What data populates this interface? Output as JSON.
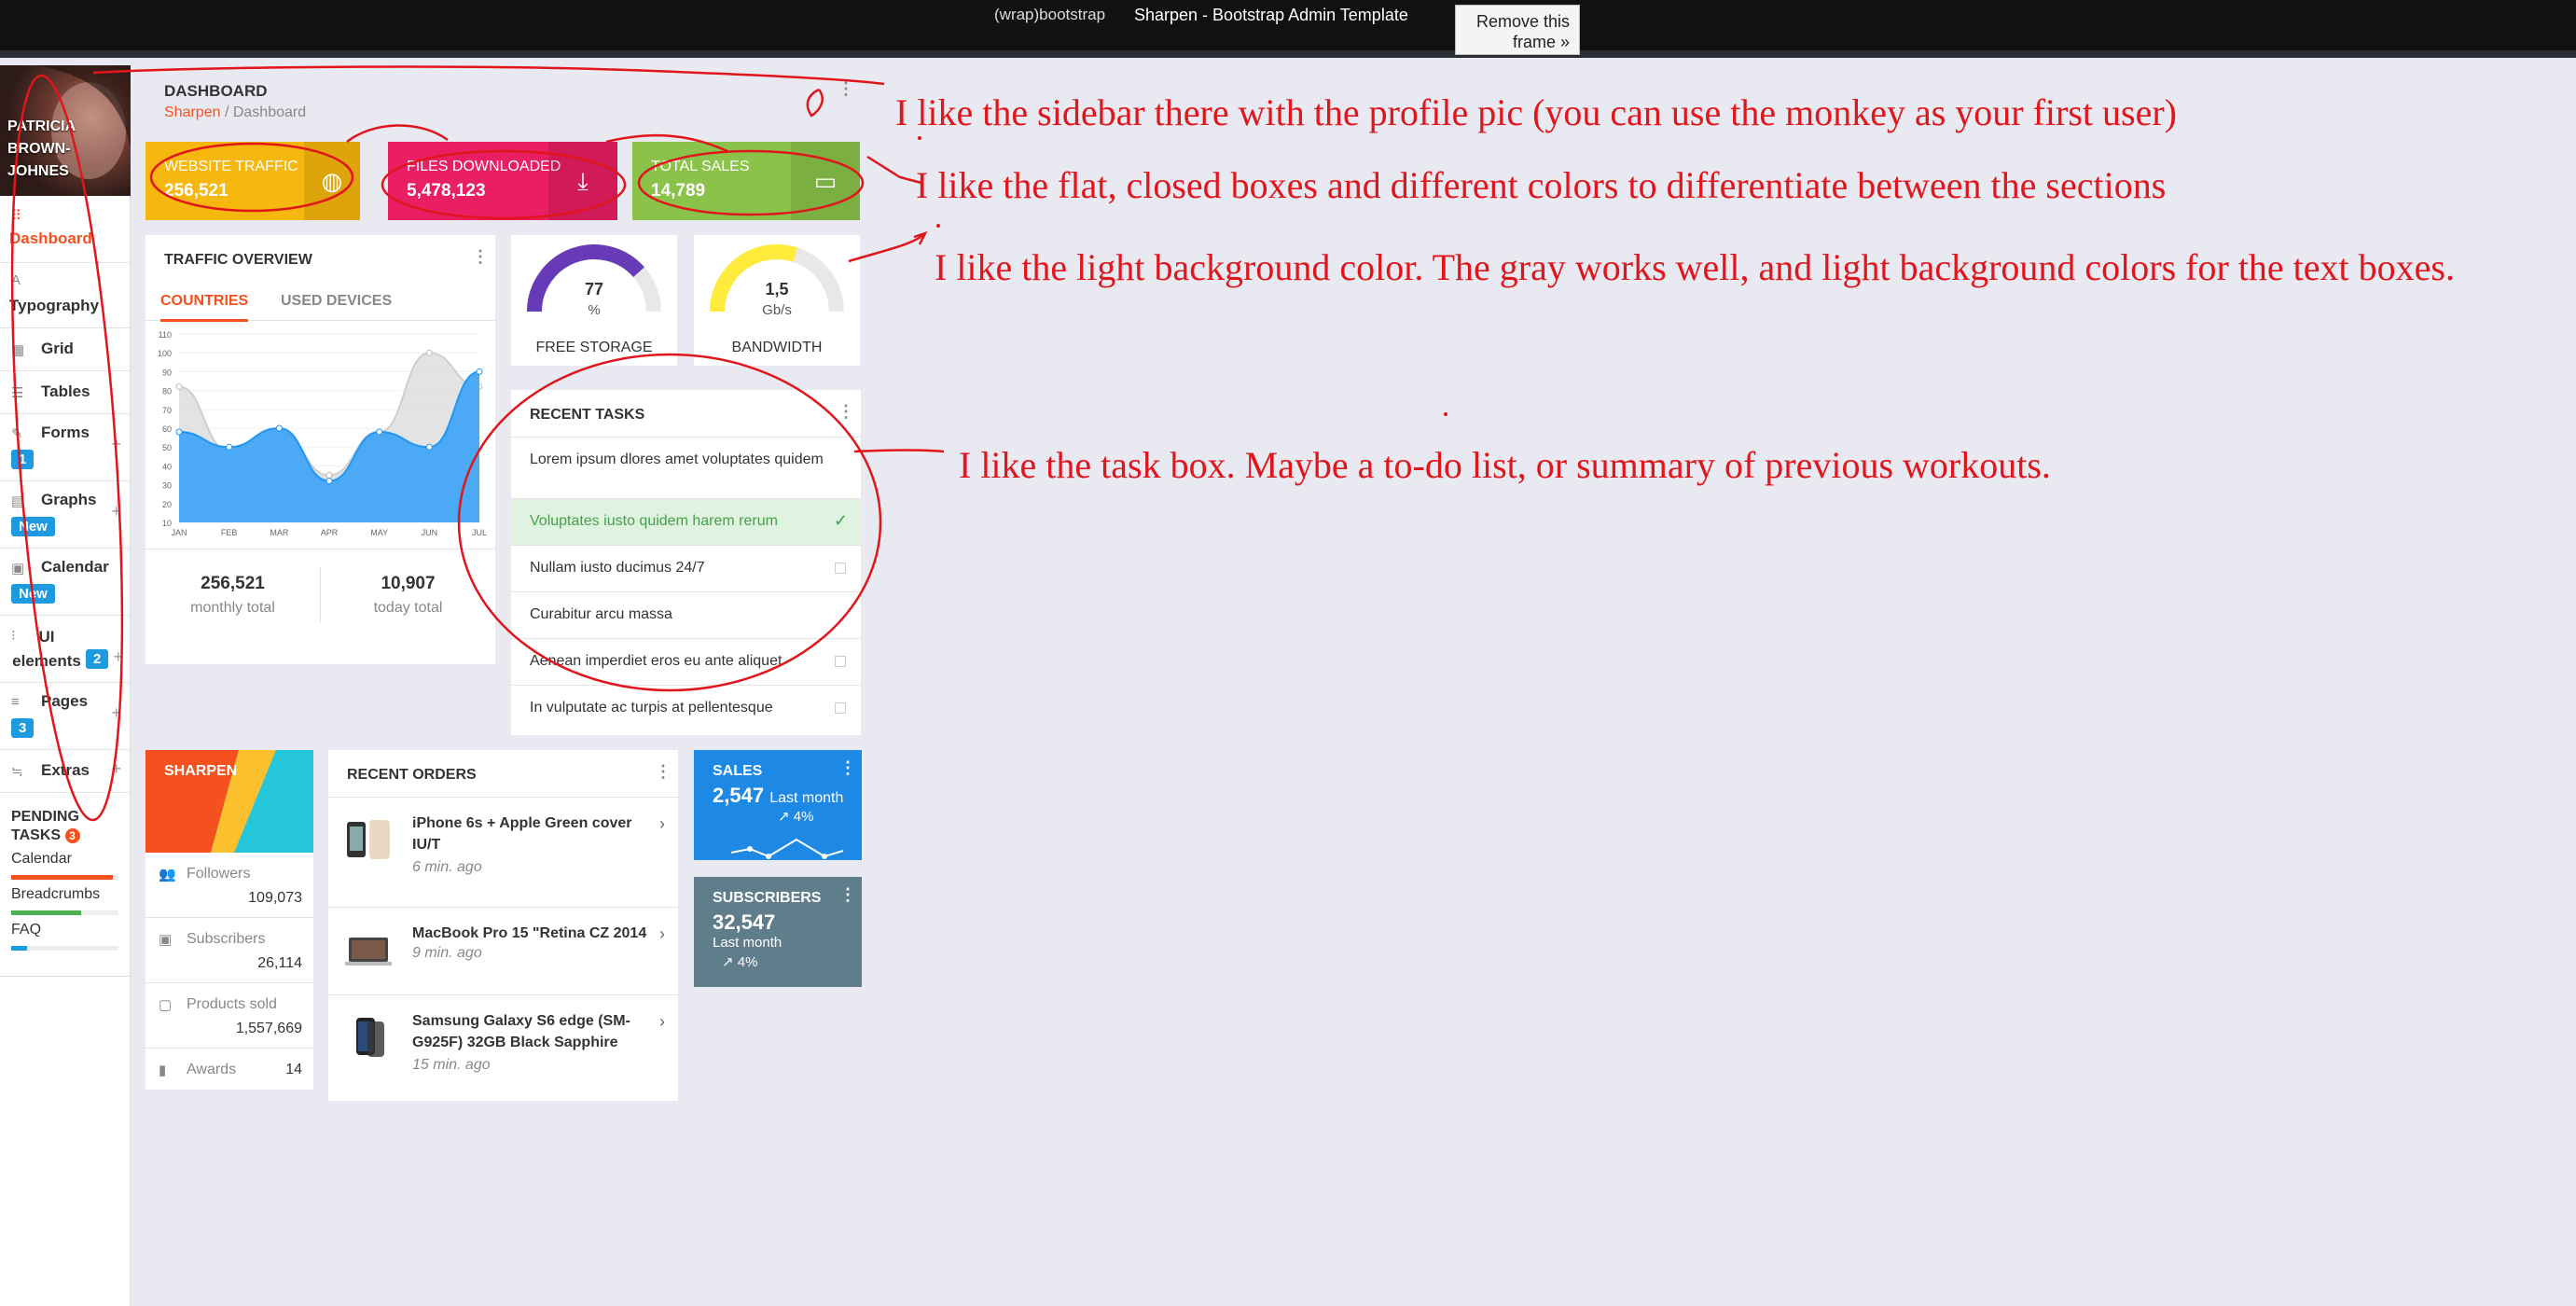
{
  "topbar": {
    "brand": "(wrap)bootstrap",
    "title": "Sharpen - Bootstrap Admin Template",
    "remove_button": "Remove this frame »"
  },
  "sidebar": {
    "profile_name": "PATRICIA BROWN-JOHNES",
    "items": [
      {
        "label": "Dashboard",
        "icon": "grid-dots-icon",
        "active": true
      },
      {
        "label": "Typography",
        "icon": "text-icon"
      },
      {
        "label": "Grid",
        "icon": "grid-icon"
      },
      {
        "label": "Tables",
        "icon": "table-icon"
      },
      {
        "label": "Forms",
        "icon": "pencil-icon",
        "badge": "1"
      },
      {
        "label": "Graphs",
        "icon": "chart-icon",
        "badge": "New"
      },
      {
        "label": "Calendar",
        "icon": "calendar-icon",
        "badge": "New"
      },
      {
        "label": "UI elements",
        "icon": "elements-icon",
        "badge": "2"
      },
      {
        "label": "Pages",
        "icon": "pages-icon",
        "badge": "3"
      },
      {
        "label": "Extras",
        "icon": "extras-icon"
      }
    ],
    "pending": {
      "title": "PENDING TASKS",
      "count": "3",
      "tasks": [
        {
          "label": "Calendar",
          "progress": 0.95,
          "color": "#f4511e"
        },
        {
          "label": "Breadcrumbs",
          "progress": 0.65,
          "color": "#4caf50"
        },
        {
          "label": "FAQ",
          "progress": 0.15,
          "color": "#1e9ae0"
        }
      ]
    }
  },
  "page": {
    "title": "DASHBOARD",
    "crumb1": "Sharpen",
    "sep": " / ",
    "crumb2": "Dashboard"
  },
  "stats": [
    {
      "label": "WEBSITE TRAFFIC",
      "value": "256,521",
      "color": "#f6b70e",
      "icon": "globe-icon"
    },
    {
      "label": "FILES DOWNLOADED",
      "value": "5,478,123",
      "color": "#e91e63",
      "icon": "download-icon"
    },
    {
      "label": "TOTAL SALES",
      "value": "14,789",
      "color": "#8bc34a",
      "icon": "card-icon"
    }
  ],
  "traffic": {
    "title": "TRAFFIC OVERVIEW",
    "tabs": [
      "COUNTRIES",
      "USED DEVICES"
    ],
    "monthly_value": "256,521",
    "monthly_label": "monthly total",
    "today_value": "10,907",
    "today_label": "today total"
  },
  "chart_data": {
    "type": "area",
    "x": [
      "JAN",
      "FEB",
      "MAR",
      "APR",
      "MAY",
      "JUN",
      "JUL"
    ],
    "yticks": [
      10,
      20,
      30,
      40,
      50,
      60,
      70,
      80,
      90,
      100,
      110
    ],
    "ylim": [
      10,
      110
    ],
    "series": [
      {
        "values": [
          82,
          48,
          58,
          35,
          58,
          100,
          82
        ],
        "color": "#dcdcdc"
      },
      {
        "values": [
          58,
          50,
          60,
          32,
          58,
          50,
          90
        ],
        "color": "#42a5f5"
      }
    ]
  },
  "gauges": [
    {
      "value": "77",
      "unit": "%",
      "label": "FREE STORAGE",
      "level": 0.77,
      "color": "#673ab7"
    },
    {
      "value": "1,5",
      "unit": "Gb/s",
      "label": "BANDWIDTH",
      "level": 0.6,
      "color": "#ffeb3b"
    }
  ],
  "tasks": {
    "title": "RECENT TASKS",
    "items": [
      {
        "text": "Lorem ipsum dlores amet voluptates quidem",
        "done": false,
        "check": false
      },
      {
        "text": "Voluptates iusto quidem harem rerum",
        "done": true,
        "check": false
      },
      {
        "text": "Nullam iusto ducimus 24/7",
        "done": false,
        "check": true
      },
      {
        "text": "Curabitur arcu massa",
        "done": false,
        "check": false
      },
      {
        "text": "Aenean imperdiet eros eu ante aliquet",
        "done": false,
        "check": true
      },
      {
        "text": "In vulputate ac turpis at pellentesque",
        "done": false,
        "check": true
      }
    ]
  },
  "social": {
    "banner": "SHARPEN",
    "rows": [
      {
        "label": "Followers",
        "value": "109,073",
        "icon": "users-icon"
      },
      {
        "label": "Subscribers",
        "value": "26,114",
        "icon": "subscribers-icon"
      },
      {
        "label": "Products sold",
        "value": "1,557,669",
        "icon": "clipboard-icon"
      },
      {
        "label": "Awards",
        "value": "14",
        "icon": "bookmark-icon"
      }
    ]
  },
  "orders": {
    "title": "RECENT ORDERS",
    "items": [
      {
        "name": "iPhone 6s + Apple Green cover IU/T",
        "time": "6 min. ago"
      },
      {
        "name": "MacBook Pro 15 \"Retina CZ 2014",
        "time": "9 min. ago"
      },
      {
        "name": "Samsung Galaxy S6 edge (SM-G925F) 32GB Black Sapphire",
        "time": "15 min. ago"
      }
    ]
  },
  "sales": {
    "title": "SALES",
    "value": "2,547",
    "sub": "Last month",
    "pct": "4%",
    "color": "#1e88e5"
  },
  "subscribers": {
    "title": "SUBSCRIBERS",
    "value": "32,547",
    "sub": "Last month",
    "pct": "4%",
    "color": "#607d8b"
  },
  "notes": [
    "I like the sidebar there with the profile pic (you can use the monkey as your first user)",
    "I like the flat, closed boxes and different colors to differentiate between the sections",
    "I like the light background color. The gray works well, and light background colors for the text boxes.",
    "I like the task box. Maybe a to-do list, or summary of previous workouts."
  ]
}
